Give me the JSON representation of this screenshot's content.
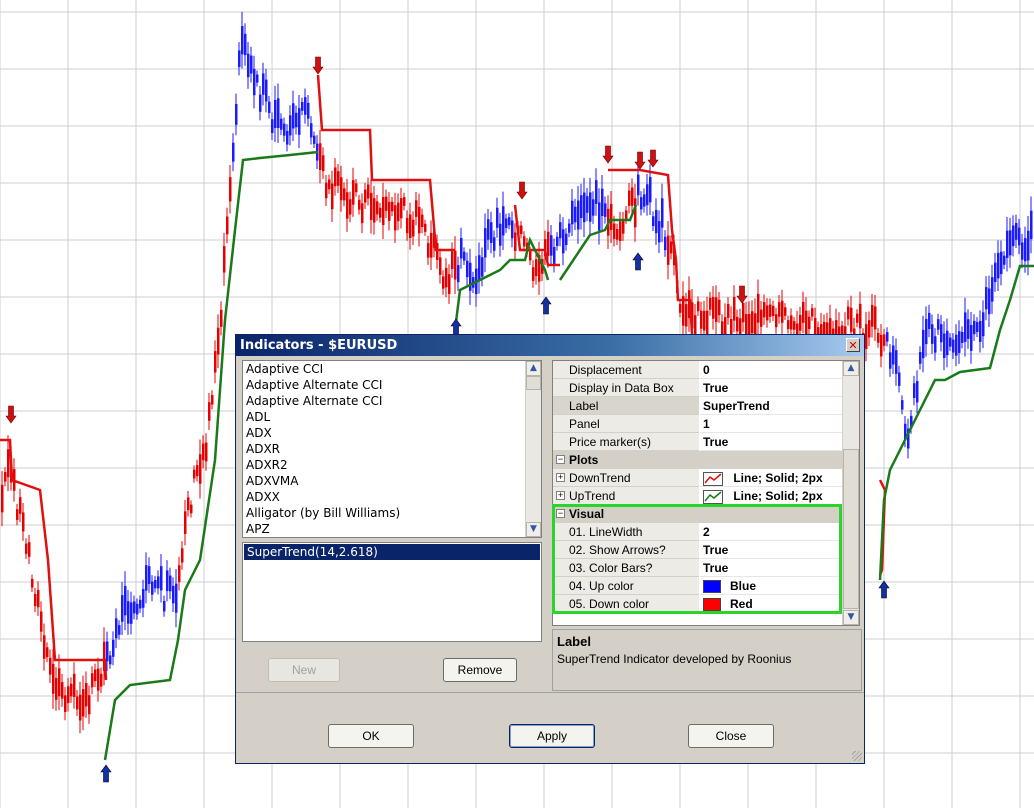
{
  "chart": {
    "colors": {
      "up_bar": "#1a1aff",
      "down_bar": "#e60000",
      "uptrend": "#1a7a1a",
      "downtrend": "#e01010",
      "grid": "#cfcfcf",
      "arrow_up": "#1530a0",
      "arrow_down": "#d01010"
    }
  },
  "dialog": {
    "title": "Indicators - $EURUSD",
    "close_glyph": "✕",
    "indicator_list": [
      "Adaptive  CCI",
      "Adaptive Alternate CCI",
      "Adaptive Alternate CCI",
      "ADL",
      "ADX",
      "ADXR",
      "ADXR2",
      "ADXVMA",
      "ADXX",
      "Alligator (by Bill Williams)",
      "APZ"
    ],
    "added_indicators": [
      "SuperTrend(14,2.618)"
    ],
    "buttons": {
      "new": "New",
      "remove": "Remove",
      "ok": "OK",
      "apply": "Apply",
      "close": "Close"
    },
    "properties": {
      "general": [
        {
          "name": "Displacement",
          "value": "0"
        },
        {
          "name": "Display in Data Box",
          "value": "True"
        },
        {
          "name": "Label",
          "value": "SuperTrend"
        },
        {
          "name": "Panel",
          "value": "1"
        },
        {
          "name": "Price marker(s)",
          "value": "True"
        }
      ],
      "plots_title": "Plots",
      "plots": [
        {
          "name": "DownTrend",
          "value": "Line; Solid; 2px",
          "color": "#e01010"
        },
        {
          "name": "UpTrend",
          "value": "Line; Solid; 2px",
          "color": "#1a7a1a"
        }
      ],
      "visual_title": "Visual",
      "visual": [
        {
          "name": "01. LineWidth",
          "value": "2"
        },
        {
          "name": "02. Show Arrows?",
          "value": "True"
        },
        {
          "name": "03. Color Bars?",
          "value": "True"
        },
        {
          "name": "04. Up color",
          "value": "Blue",
          "color": "#0000ff"
        },
        {
          "name": "05. Down color",
          "value": "Red",
          "color": "#ff0000"
        }
      ],
      "expand_glyph": "⊞",
      "collapse_glyph": "⊟"
    },
    "description": {
      "title": "Label",
      "text": "SuperTrend Indicator developed by Roonius"
    }
  }
}
